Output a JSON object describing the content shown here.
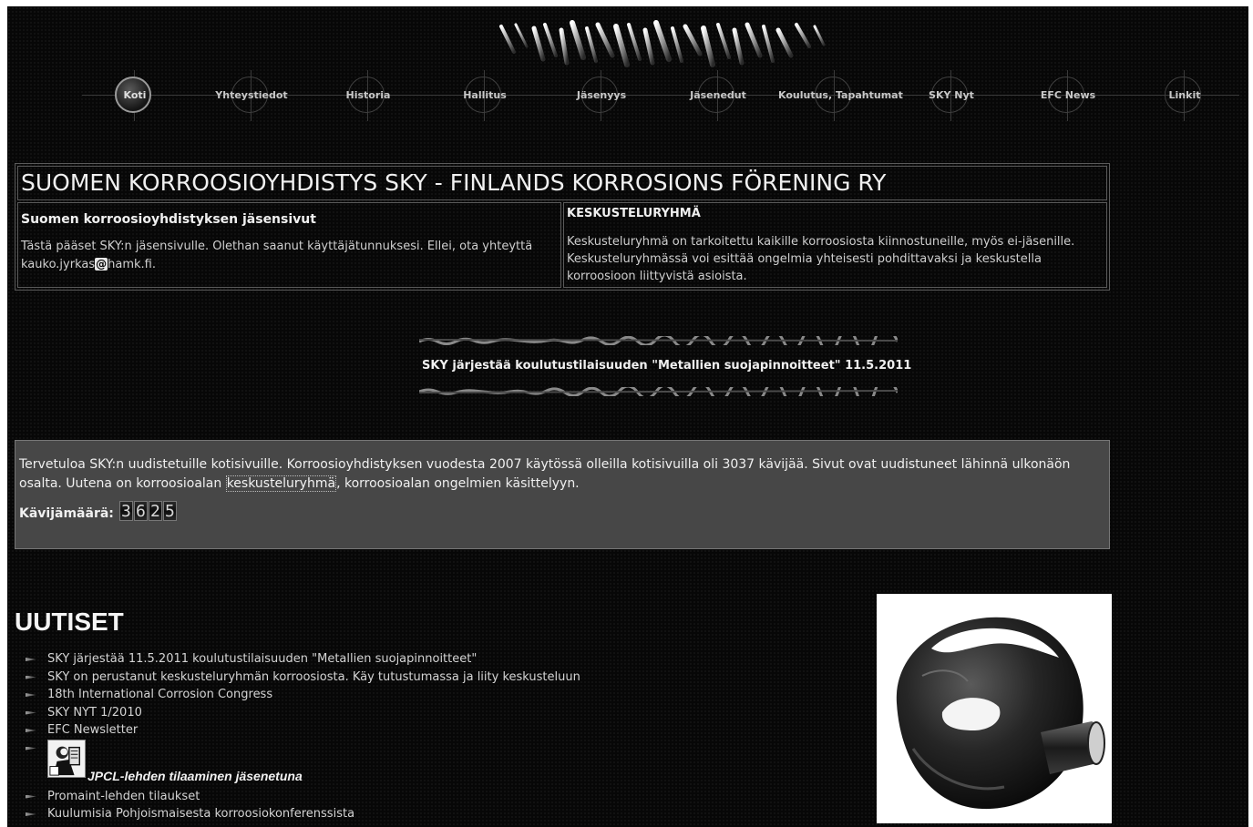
{
  "nav": {
    "items": [
      {
        "label": "Koti",
        "active": true
      },
      {
        "label": "Yhteystiedot"
      },
      {
        "label": "Historia"
      },
      {
        "label": "Hallitus"
      },
      {
        "label": "Jäsenyys"
      },
      {
        "label": "Jäsenedut"
      },
      {
        "label": "Koulutus, Tapahtumat"
      },
      {
        "label": "SKY Nyt"
      },
      {
        "label": "EFC News"
      },
      {
        "label": "Linkit"
      }
    ]
  },
  "header": {
    "title": "SUOMEN KORROOSIOYHDISTYS SKY - FINLANDS KORROSIONS FÖRENING RY",
    "members": {
      "title": "Suomen korroosioyhdistyksen jäsensivut",
      "text": "Tästä pääset SKY:n jäsensivulle. Olethan saanut käyttäjätunnuksesi. Ellei, ota yhteyttä",
      "email_user": "kauko.jyrkas",
      "email_at": "@",
      "email_domain": "hamk.fi."
    },
    "discussion": {
      "title": "KESKUSTELURYHMÄ",
      "text": "Keskusteluryhmä on tarkoitettu kaikille korroosiosta kiinnostuneille, myös ei-jäsenille. Keskusteluryhmässä voi esittää ongelmia yhteisesti pohdittavaksi ja keskustella korroosioon liittyvistä asioista."
    }
  },
  "announcement": "SKY järjestää koulutustilaisuuden \"Metallien suojapinnoitteet\" 11.5.2011",
  "welcome": {
    "text_before": "Tervetuloa SKY:n uudistetuille kotisivuille. Korroosioyhdistyksen vuodesta 2007 käytössä olleilla kotisivuilla oli 3037 kävijää. Sivut ovat uudistuneet lähinnä ulkonäön osalta. Uutena on korroosioalan ",
    "link": "keskusteluryhmä",
    "text_after": ", korroosioalan ongelmien käsittelyyn.",
    "counter_label": "Kävijämäärä:",
    "counter_digits": [
      "3",
      "6",
      "2",
      "5"
    ]
  },
  "news": {
    "title": "UUTISET",
    "items": [
      "SKY järjestää 11.5.2011 koulutustilaisuuden \"Metallien suojapinnoitteet\"",
      "SKY on perustanut keskusteluryhmän korroosiosta. Käy tutustumassa ja liity keskusteluun",
      "18th International Corrosion Congress",
      "SKY NYT 1/2010",
      "EFC Newsletter"
    ],
    "jpcl_label": "JPCL-lehden tilaaminen jäsenetuna",
    "items_after": [
      "Promaint-lehden tilaukset",
      "Kuulumisia Pohjoismaisesta korroosiokonferenssista"
    ]
  },
  "colors": {
    "background": "#070707",
    "welcome_box": "#474747",
    "text": "#f0f0f0"
  }
}
